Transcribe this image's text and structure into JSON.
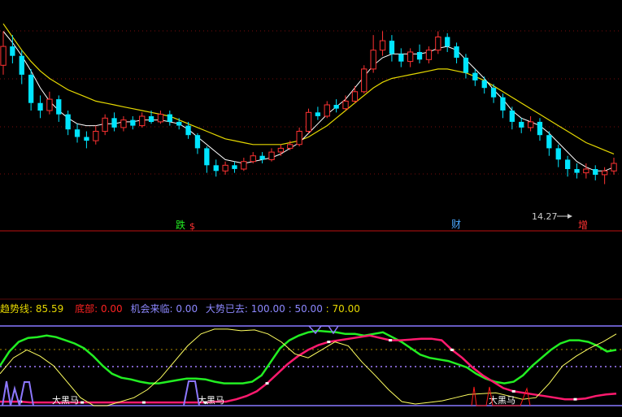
{
  "colors": {
    "background": "#000000",
    "up": "#ff3232",
    "down": "#00e5ff",
    "ma_short": "#ffffff",
    "ma_long": "#e5d800",
    "divider": "#ff0000",
    "grid_red": "#a01010",
    "band": "#8878ff",
    "green_line": "#22ee22",
    "magenta_line": "#ff1a6e",
    "yellow_line": "#ffff60",
    "dot_line": "#a27dff"
  },
  "main_panel": {
    "signal_fall": "跌",
    "signal_dollar": "$",
    "signal_money": "财",
    "signal_grow": "增",
    "low_price_label": "14.27"
  },
  "indicator": {
    "trend_label": "趋势线",
    "trend_value": "85.59",
    "bottom_label": "底部",
    "bottom_value": "0.00",
    "chance_label": "机会来临",
    "chance_value": "0.00",
    "gone_label": "大势已去",
    "level_100": "100.00",
    "level_50": "50.00",
    "level_70": "70.00",
    "horse_label": "大黑马"
  },
  "chart_data": [
    {
      "type": "candlestick",
      "title": "",
      "series": [
        {
          "name": "price",
          "values": [
            [
              22.0,
              23.0,
              23.8,
              21.5
            ],
            [
              23.0,
              22.5,
              23.6,
              22.1
            ],
            [
              22.5,
              21.5,
              22.8,
              21.0
            ],
            [
              21.5,
              20.0,
              21.8,
              19.6
            ],
            [
              20.0,
              19.6,
              20.4,
              19.2
            ],
            [
              19.6,
              20.2,
              20.6,
              19.4
            ],
            [
              20.2,
              19.4,
              20.4,
              19.0
            ],
            [
              19.4,
              18.6,
              19.6,
              18.3
            ],
            [
              18.6,
              18.2,
              18.9,
              17.9
            ],
            [
              18.2,
              18.0,
              18.5,
              17.6
            ],
            [
              18.0,
              18.5,
              18.8,
              17.8
            ],
            [
              18.5,
              19.2,
              19.4,
              18.3
            ],
            [
              19.2,
              18.7,
              19.5,
              18.5
            ],
            [
              18.7,
              19.1,
              19.3,
              18.5
            ],
            [
              19.1,
              18.8,
              19.3,
              18.6
            ],
            [
              18.8,
              19.3,
              19.5,
              18.7
            ],
            [
              19.3,
              19.0,
              19.6,
              18.9
            ],
            [
              19.0,
              19.4,
              19.6,
              18.9
            ],
            [
              19.4,
              19.0,
              19.6,
              18.8
            ],
            [
              19.0,
              18.8,
              19.2,
              18.6
            ],
            [
              18.8,
              18.3,
              19.0,
              18.1
            ],
            [
              18.3,
              17.6,
              18.4,
              17.3
            ],
            [
              17.6,
              16.7,
              17.7,
              16.3
            ],
            [
              16.7,
              16.4,
              17.0,
              16.1
            ],
            [
              16.4,
              16.7,
              16.9,
              16.2
            ],
            [
              16.7,
              16.5,
              16.9,
              16.3
            ],
            [
              16.5,
              16.9,
              17.1,
              16.4
            ],
            [
              16.9,
              17.2,
              17.4,
              16.8
            ],
            [
              17.2,
              17.0,
              17.4,
              16.8
            ],
            [
              17.0,
              17.4,
              17.6,
              16.9
            ],
            [
              17.4,
              17.6,
              17.8,
              17.2
            ],
            [
              17.6,
              17.8,
              18.0,
              17.5
            ],
            [
              17.8,
              18.5,
              18.7,
              17.7
            ],
            [
              18.5,
              19.5,
              19.7,
              18.4
            ],
            [
              19.5,
              19.3,
              19.8,
              19.1
            ],
            [
              19.3,
              19.9,
              20.1,
              19.2
            ],
            [
              19.9,
              19.7,
              20.2,
              19.5
            ],
            [
              19.7,
              20.1,
              20.4,
              19.6
            ],
            [
              20.1,
              20.6,
              20.9,
              20.0
            ],
            [
              20.6,
              21.8,
              22.0,
              20.5
            ],
            [
              21.8,
              22.8,
              23.6,
              21.6
            ],
            [
              22.8,
              23.3,
              23.8,
              22.5
            ],
            [
              23.3,
              22.6,
              23.6,
              22.2
            ],
            [
              22.6,
              22.2,
              22.9,
              21.9
            ],
            [
              22.2,
              22.7,
              22.9,
              21.9
            ],
            [
              22.7,
              22.3,
              23.1,
              22.1
            ],
            [
              22.3,
              22.8,
              23.0,
              22.1
            ],
            [
              22.8,
              23.5,
              23.8,
              22.6
            ],
            [
              23.5,
              23.0,
              23.7,
              22.7
            ],
            [
              23.0,
              22.4,
              23.2,
              22.1
            ],
            [
              22.4,
              21.6,
              22.6,
              21.3
            ],
            [
              21.6,
              21.2,
              21.8,
              20.9
            ],
            [
              21.2,
              20.8,
              21.4,
              20.5
            ],
            [
              20.8,
              20.3,
              21.0,
              20.0
            ],
            [
              20.3,
              19.6,
              20.5,
              19.2
            ],
            [
              19.6,
              19.0,
              19.8,
              18.6
            ],
            [
              19.0,
              18.7,
              19.2,
              18.4
            ],
            [
              18.7,
              19.0,
              19.3,
              18.5
            ],
            [
              19.0,
              18.3,
              19.2,
              18.0
            ],
            [
              18.3,
              17.6,
              18.5,
              17.2
            ],
            [
              17.6,
              17.0,
              17.8,
              16.6
            ],
            [
              17.0,
              16.5,
              17.2,
              16.1
            ],
            [
              16.5,
              16.3,
              16.8,
              16.0
            ],
            [
              16.3,
              16.5,
              16.8,
              16.0
            ],
            [
              16.5,
              16.2,
              16.7,
              15.9
            ],
            [
              16.2,
              16.4,
              16.6,
              15.7
            ],
            [
              16.4,
              16.8,
              17.1,
              16.2
            ]
          ]
        },
        {
          "name": "ma_short",
          "values": [
            23.8,
            23.2,
            22.5,
            21.7,
            20.8,
            20.1,
            19.6,
            19.2,
            18.9,
            18.8,
            18.8,
            18.9,
            18.9,
            19.0,
            19.0,
            19.1,
            19.1,
            19.1,
            19.0,
            18.9,
            18.6,
            18.2,
            17.8,
            17.4,
            17.0,
            16.9,
            16.8,
            16.9,
            17.0,
            17.1,
            17.3,
            17.6,
            17.9,
            18.4,
            18.9,
            19.4,
            19.8,
            20.2,
            20.8,
            21.4,
            22.0,
            22.4,
            22.6,
            22.6,
            22.6,
            22.6,
            22.7,
            22.9,
            23.0,
            22.8,
            22.3,
            21.8,
            21.3,
            20.7,
            20.2,
            19.6,
            19.2,
            19.0,
            18.8,
            18.4,
            17.9,
            17.4,
            16.9,
            16.6,
            16.4,
            16.4,
            16.6
          ]
        },
        {
          "name": "ma_long",
          "values": [
            24.2,
            23.5,
            22.8,
            22.2,
            21.7,
            21.3,
            21.0,
            20.7,
            20.5,
            20.3,
            20.1,
            20.0,
            19.9,
            19.8,
            19.7,
            19.6,
            19.5,
            19.4,
            19.3,
            19.1,
            18.9,
            18.7,
            18.5,
            18.3,
            18.1,
            18.0,
            17.9,
            17.8,
            17.8,
            17.8,
            17.8,
            17.9,
            18.0,
            18.2,
            18.5,
            18.8,
            19.2,
            19.6,
            20.0,
            20.4,
            20.8,
            21.1,
            21.3,
            21.4,
            21.5,
            21.6,
            21.7,
            21.8,
            21.8,
            21.7,
            21.6,
            21.4,
            21.2,
            20.9,
            20.6,
            20.3,
            20.0,
            19.7,
            19.4,
            19.1,
            18.8,
            18.5,
            18.2,
            17.9,
            17.7,
            17.5,
            17.3
          ]
        }
      ],
      "y_low_label": "14.27"
    },
    {
      "type": "line",
      "title": "",
      "ylim": [
        0,
        100
      ],
      "levels": [
        100,
        50,
        70
      ],
      "series": [
        {
          "name": "趋势线",
          "values": [
            50,
            68,
            80,
            85,
            86,
            88,
            86,
            82,
            78,
            72,
            62,
            50,
            40,
            35,
            33,
            30,
            28,
            28,
            30,
            32,
            34,
            34,
            33,
            30,
            28,
            28,
            28,
            30,
            38,
            55,
            72,
            82,
            88,
            92,
            94,
            93,
            92,
            90,
            90,
            88,
            90,
            92,
            86,
            80,
            72,
            64,
            60,
            58,
            56,
            52,
            48,
            40,
            34,
            30,
            28,
            30,
            38,
            50,
            60,
            70,
            78,
            82,
            82,
            80,
            75,
            68,
            70
          ]
        },
        {
          "name": "底部",
          "values": [
            5,
            5,
            5,
            4,
            4,
            4,
            4,
            4,
            4,
            4,
            4,
            4,
            4,
            4,
            4,
            4,
            4,
            4,
            4,
            4,
            4,
            5,
            5,
            8,
            12,
            18,
            28,
            40,
            52,
            62,
            70,
            76,
            80,
            82,
            84,
            86,
            88,
            85,
            82,
            82,
            83,
            84,
            84,
            82,
            70,
            60,
            48,
            38,
            30,
            22,
            18,
            16,
            14,
            12,
            10,
            8,
            8,
            9,
            12,
            14,
            15
          ]
        },
        {
          "name": "机会来临",
          "values": [
            0,
            0,
            0,
            0,
            0,
            0,
            0,
            0,
            0,
            0,
            0,
            0,
            0,
            0,
            0,
            0,
            0,
            0,
            0,
            0,
            0,
            0,
            0,
            0,
            0,
            0,
            0,
            0,
            0,
            0,
            0,
            0,
            0,
            0,
            0,
            0,
            0,
            0,
            0,
            0,
            0,
            0,
            0,
            0,
            0,
            0,
            0,
            0,
            0,
            0,
            0,
            0,
            0,
            0,
            0,
            0,
            0,
            0,
            0,
            0,
            0
          ]
        },
        {
          "name": "大势已去",
          "values": [
            40,
            60,
            70,
            62,
            50,
            30,
            10,
            0,
            0,
            5,
            10,
            20,
            35,
            55,
            75,
            90,
            96,
            96,
            94,
            95,
            90,
            80,
            65,
            60,
            70,
            80,
            75,
            55,
            38,
            20,
            5,
            2,
            4,
            6,
            10,
            14,
            15,
            16,
            12,
            8,
            10,
            28,
            50,
            62,
            72,
            80,
            90
          ]
        }
      ],
      "current": {
        "趋势线": 85.59,
        "底部": 0.0,
        "机会来临": 0.0
      }
    }
  ]
}
